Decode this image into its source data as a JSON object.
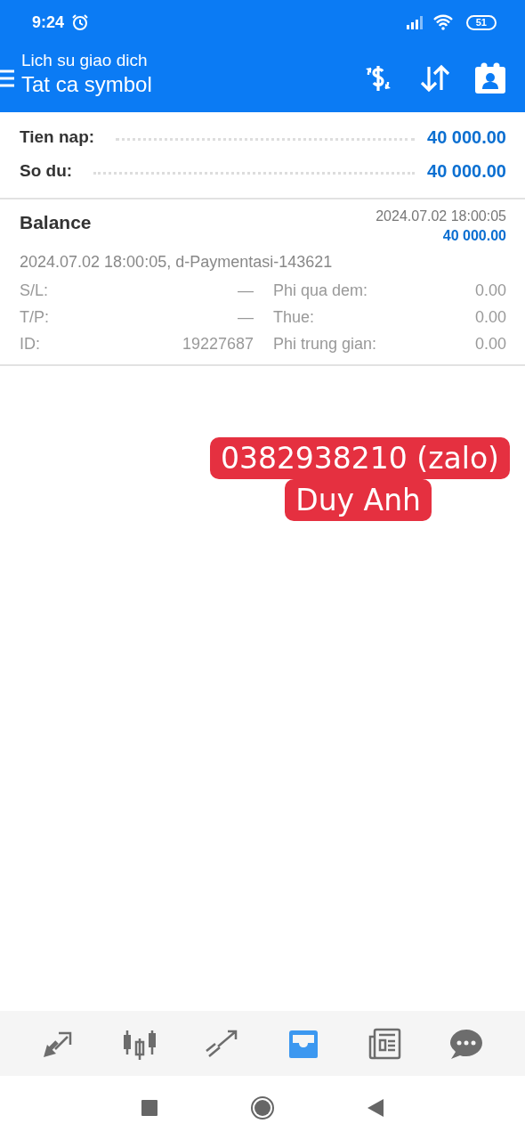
{
  "status_bar": {
    "time": "9:24",
    "battery": "51"
  },
  "toolbar": {
    "subtitle": "Lich su giao dich",
    "title": "Tat ca symbol"
  },
  "summary": [
    {
      "label": "Tien nap:",
      "value": "40 000.00"
    },
    {
      "label": "So du:",
      "value": "40 000.00"
    }
  ],
  "deal": {
    "type": "Balance",
    "time": "2024.07.02 18:00:05",
    "amount": "40 000.00",
    "comment": "2024.07.02 18:00:05, d-Paymentasi-143621",
    "fields_left": [
      {
        "label": "S/L:",
        "value": "—"
      },
      {
        "label": "T/P:",
        "value": "—"
      },
      {
        "label": "ID:",
        "value": "19227687"
      }
    ],
    "fields_right": [
      {
        "label": "Phi qua dem:",
        "value": "0.00"
      },
      {
        "label": "Thue:",
        "value": "0.00"
      },
      {
        "label": "Phi trung gian:",
        "value": "0.00"
      }
    ]
  },
  "overlay_note": [
    "0382938210 (zalo)",
    "Duy Anh"
  ],
  "bottom_tabs": [
    {
      "kind": "trade",
      "selected": false
    },
    {
      "kind": "chart",
      "selected": false
    },
    {
      "kind": "trend",
      "selected": false
    },
    {
      "kind": "history",
      "selected": true
    },
    {
      "kind": "news",
      "selected": false
    },
    {
      "kind": "chat",
      "selected": false
    }
  ]
}
